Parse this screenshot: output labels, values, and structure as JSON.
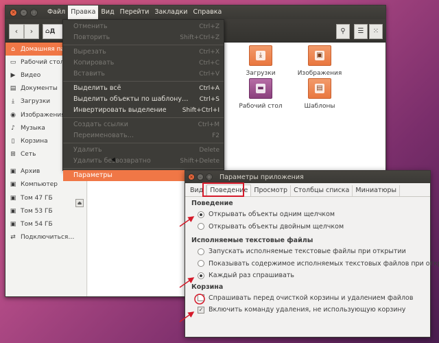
{
  "menubar": {
    "items": [
      "Файл",
      "Правка",
      "Вид",
      "Перейти",
      "Закладки",
      "Справка"
    ],
    "active_index": 1
  },
  "toolbar": {
    "back_icon": "back-arrow-icon",
    "forward_icon": "forward-arrow-icon",
    "path_label": "Д",
    "path_icon": "home-icon",
    "search_icon": "search-icon",
    "list_view_icon": "list-view-icon",
    "grid_view_icon": "grid-view-icon"
  },
  "sidebar": {
    "items": [
      {
        "label": "Домашняя папка",
        "icon": "home-icon",
        "selected": true
      },
      {
        "label": "Рабочий стол",
        "icon": "desktop-icon"
      },
      {
        "label": "Видео",
        "icon": "video-icon"
      },
      {
        "label": "Документы",
        "icon": "document-icon"
      },
      {
        "label": "Загрузки",
        "icon": "download-icon"
      },
      {
        "label": "Изображения",
        "icon": "camera-icon"
      },
      {
        "label": "Музыка",
        "icon": "music-icon"
      },
      {
        "label": "Корзина",
        "icon": "trash-icon"
      },
      {
        "label": "Сеть",
        "icon": "network-icon"
      }
    ],
    "devices": [
      {
        "label": "Архив",
        "icon": "drive-icon"
      },
      {
        "label": "Компьютер",
        "icon": "drive-icon"
      },
      {
        "label": "Том 47 ГБ",
        "icon": "drive-icon"
      },
      {
        "label": "Том 53 ГБ",
        "icon": "drive-icon"
      },
      {
        "label": "Том 54 ГБ",
        "icon": "drive-icon"
      },
      {
        "label": "Подключиться…",
        "icon": "connect-icon"
      }
    ]
  },
  "files": [
    {
      "label": "Загрузки",
      "icon": "downloads-folder-icon",
      "color": "#e9773f"
    },
    {
      "label": "Изображения",
      "icon": "pictures-folder-icon",
      "color": "#e9773f"
    },
    {
      "label": "Рабочий стол",
      "icon": "desktop-folder-icon",
      "color": "#8a3f7d"
    },
    {
      "label": "Шаблоны",
      "icon": "templates-folder-icon",
      "color": "#e9773f"
    }
  ],
  "edit_menu": {
    "items": [
      {
        "label": "Отменить",
        "shortcut": "Ctrl+Z",
        "disabled": true
      },
      {
        "label": "Повторить",
        "shortcut": "Shift+Ctrl+Z",
        "disabled": true
      },
      {
        "sep": true
      },
      {
        "label": "Вырезать",
        "shortcut": "Ctrl+X",
        "disabled": true
      },
      {
        "label": "Копировать",
        "shortcut": "Ctrl+C",
        "disabled": true
      },
      {
        "label": "Вставить",
        "shortcut": "Ctrl+V",
        "disabled": true
      },
      {
        "sep": true
      },
      {
        "label": "Выделить всё",
        "shortcut": "Ctrl+A"
      },
      {
        "label": "Выделить объекты по шаблону…",
        "shortcut": "Ctrl+S"
      },
      {
        "label": "Инвертировать выделение",
        "shortcut": "Shift+Ctrl+I"
      },
      {
        "sep": true
      },
      {
        "label": "Создать ссылки",
        "shortcut": "Ctrl+M",
        "disabled": true
      },
      {
        "label": "Переименовать…",
        "shortcut": "F2",
        "disabled": true
      },
      {
        "sep": true
      },
      {
        "label": "Удалить",
        "shortcut": "Delete",
        "disabled": true
      },
      {
        "label": "Удалить безвозвратно",
        "shortcut": "Shift+Delete",
        "disabled": true
      },
      {
        "sep": true
      },
      {
        "label": "Параметры",
        "shortcut": "",
        "highlight": true
      }
    ]
  },
  "prefs": {
    "title": "Параметры приложения",
    "tabs": [
      "Вид",
      "Поведение",
      "Просмотр",
      "Столбцы списка",
      "Миниатюры"
    ],
    "active_tab": 1,
    "behavior": {
      "heading": "Поведение",
      "options": [
        {
          "label": "Открывать объекты одним щелчком",
          "checked": true
        },
        {
          "label": "Открывать объекты двойным щелчком",
          "checked": false
        }
      ]
    },
    "executables": {
      "heading": "Исполняемые текстовые файлы",
      "options": [
        {
          "label": "Запускать исполняемые текстовые файлы при открытии",
          "checked": false
        },
        {
          "label": "Показывать содержимое исполняемых текстовых файлов при открытии",
          "checked": false
        },
        {
          "label": "Каждый раз спрашивать",
          "checked": true
        }
      ]
    },
    "trash": {
      "heading": "Корзина",
      "options": [
        {
          "label": "Спрашивать перед очисткой корзины и удалением файлов",
          "checked": false
        },
        {
          "label": "Включить команду удаления, не использующую корзину",
          "checked": true
        }
      ]
    }
  },
  "colors": {
    "accent": "#f07746",
    "annotation": "#d51a2a"
  }
}
